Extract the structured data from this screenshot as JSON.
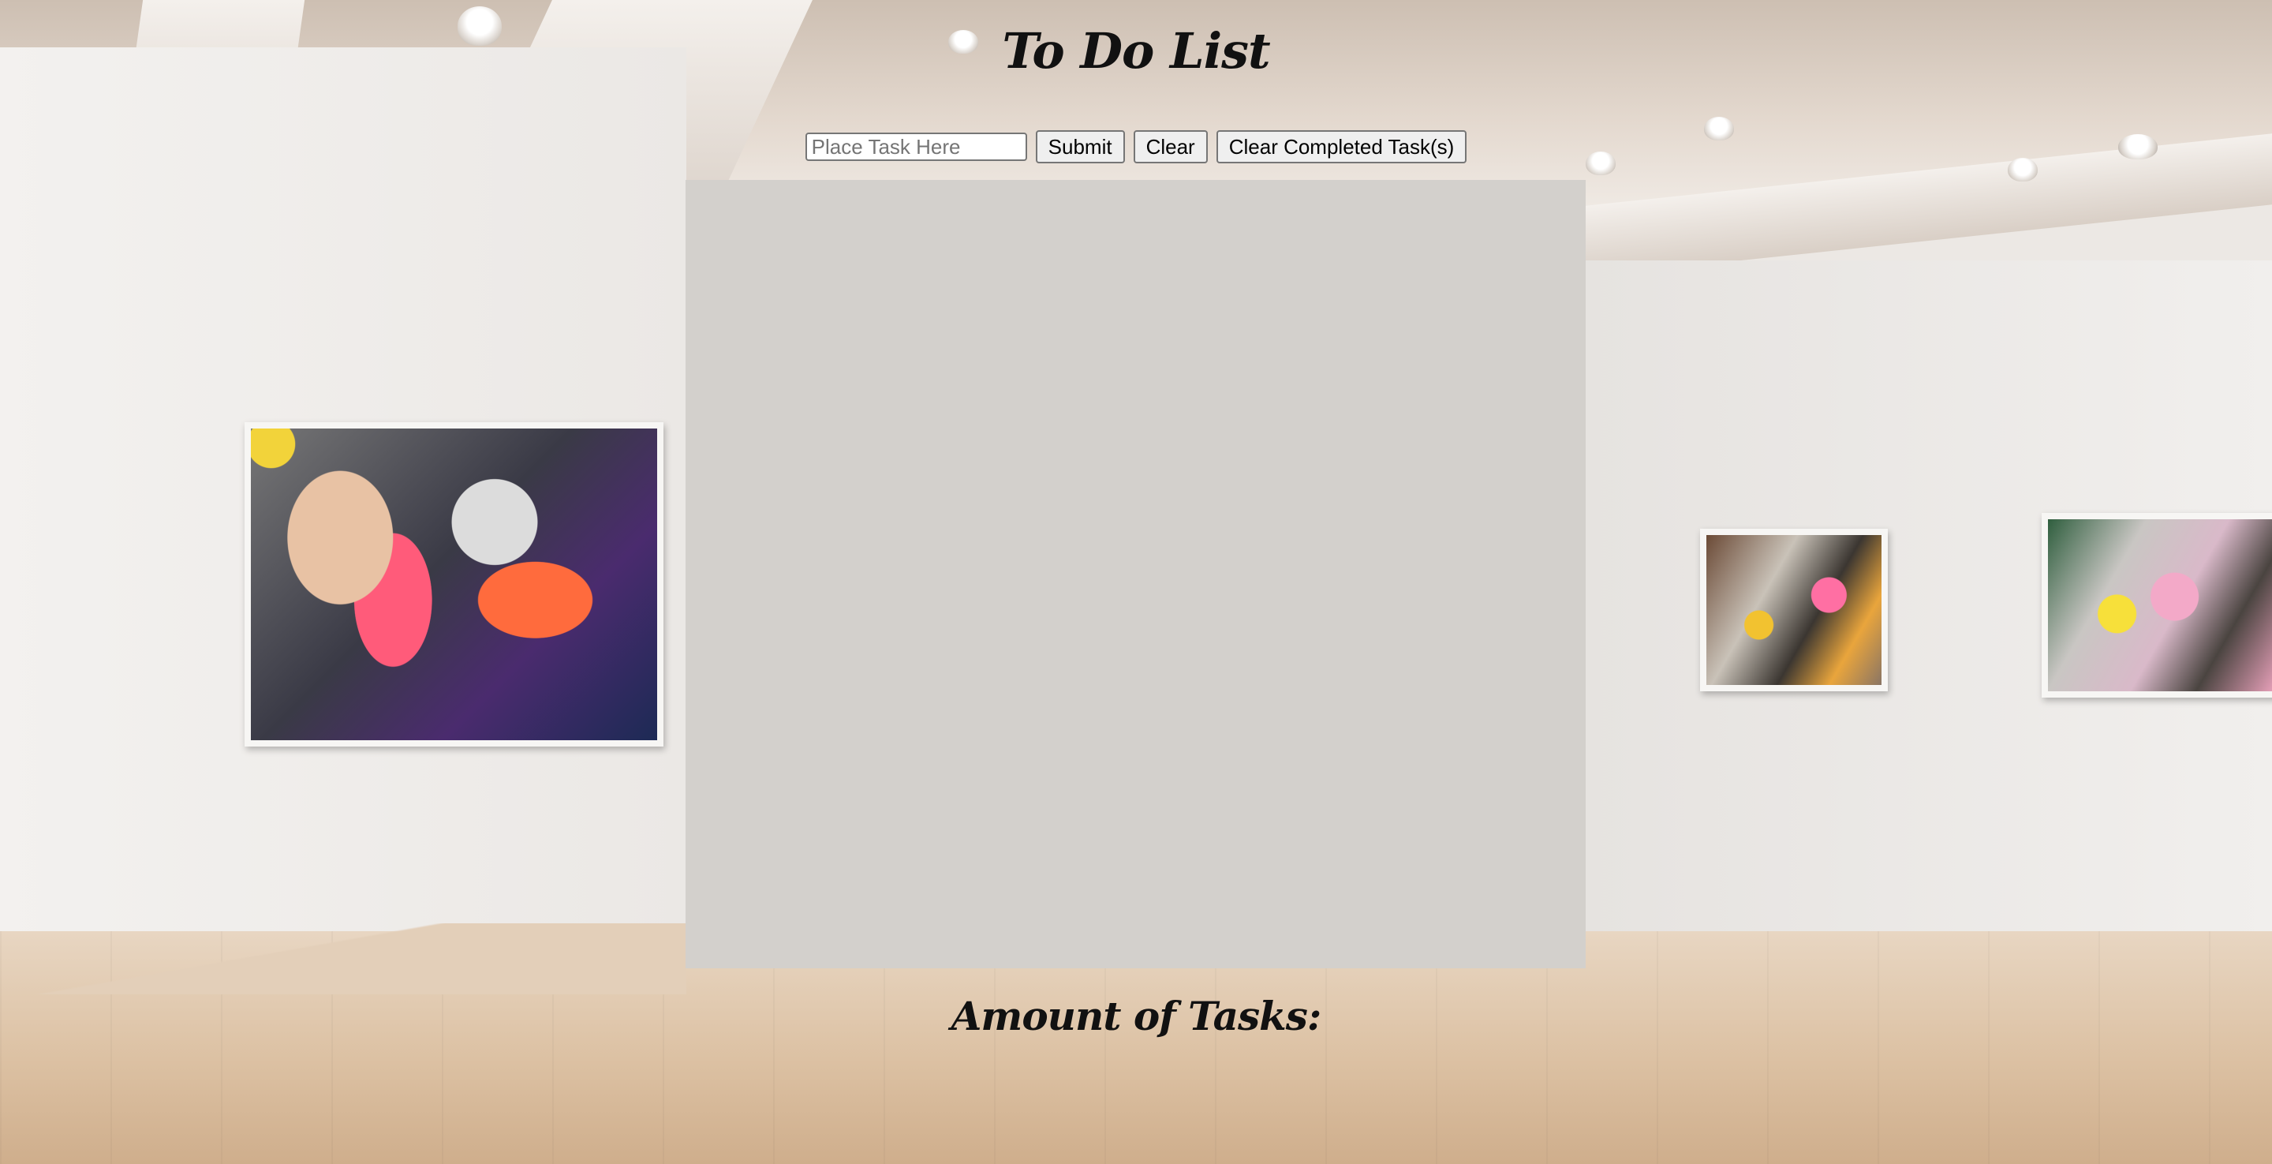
{
  "app": {
    "title": "To Do List"
  },
  "controls": {
    "task_input": {
      "value": "",
      "placeholder": "Place Task Here"
    },
    "submit_label": "Submit",
    "clear_label": "Clear",
    "clear_completed_label": "Clear Completed Task(s)"
  },
  "tasks": [],
  "footer": {
    "amount_label": "Amount of Tasks:"
  },
  "colors": {
    "panel": "#d3d0cc",
    "heading_text": "#111111"
  }
}
